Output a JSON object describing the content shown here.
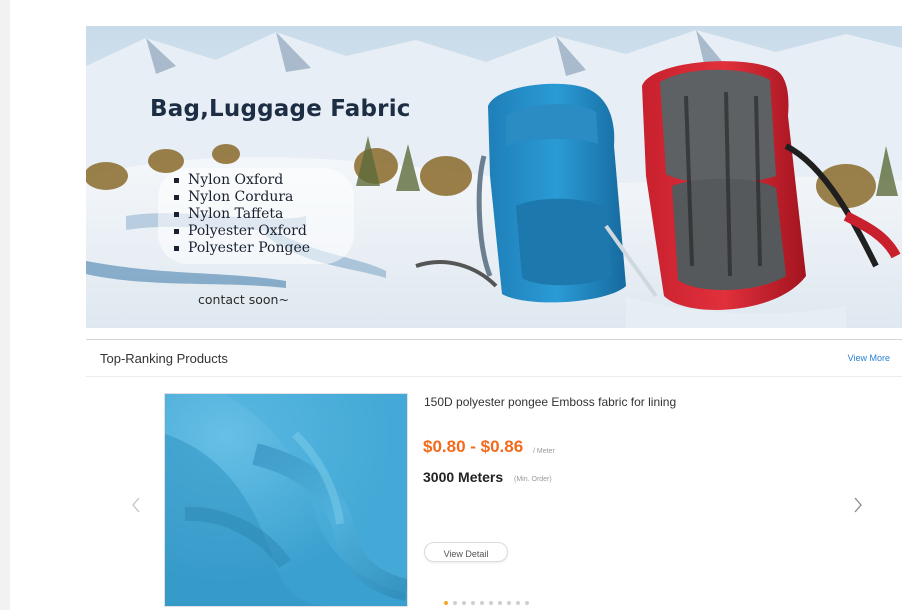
{
  "banner": {
    "title": "Bag,Luggage Fabric",
    "items": [
      "Nylon Oxford",
      "Nylon Cordura",
      "Nylon Taffeta",
      "Polyester Oxford",
      "Polyester Pongee"
    ],
    "contact": "contact soon~"
  },
  "section": {
    "title": "Top-Ranking Products",
    "view_more": "View More"
  },
  "product": {
    "name": "150D polyester pongee Emboss fabric for lining",
    "price": "$0.80 - $0.86",
    "price_unit": "/ Meter",
    "min_order": "3000 Meters",
    "min_order_label": "(Min. Order)",
    "detail_label": "View Detail"
  },
  "carousel": {
    "dot_count": 10,
    "active_dot": 1
  },
  "colors": {
    "price": "#f26a1b",
    "link": "#2a7fd4",
    "fabric_blue": "#3aa0cf",
    "active_dot": "#f5a623"
  },
  "icons": {
    "prev": "chevron-left-icon",
    "next": "chevron-right-icon"
  }
}
